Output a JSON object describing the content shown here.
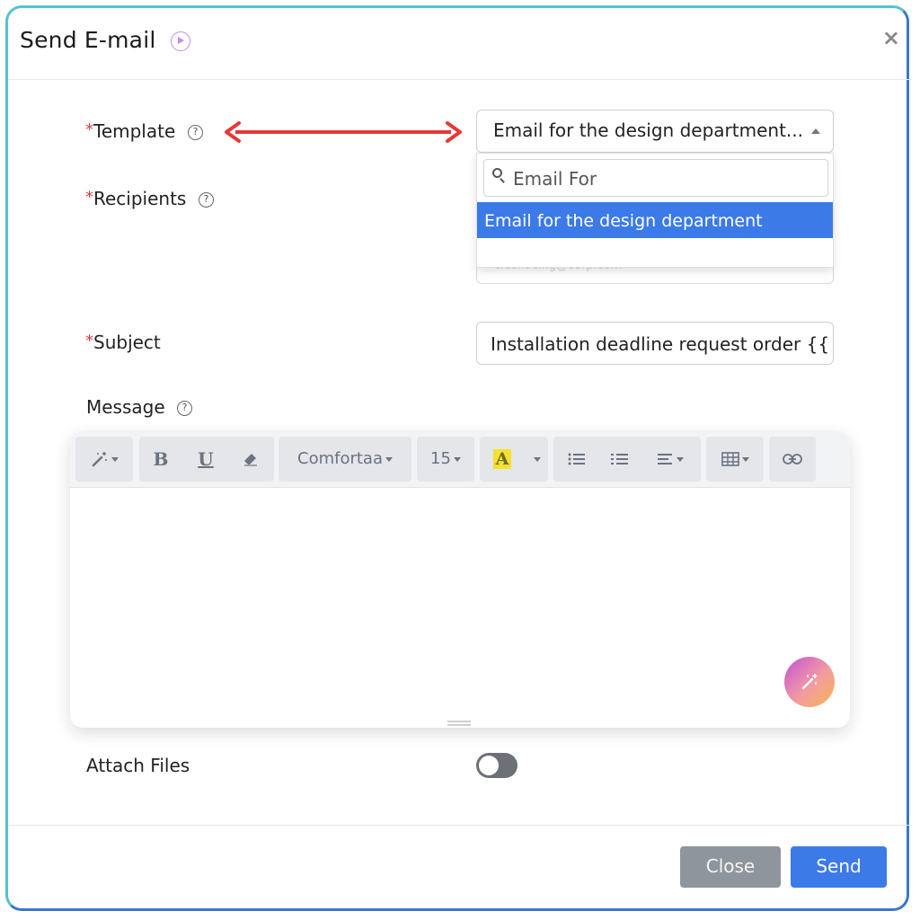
{
  "dialog": {
    "title": "Send E-mail",
    "close_symbol": "×"
  },
  "form": {
    "template": {
      "label": "Template",
      "required_mark": "*",
      "help_symbol": "?",
      "selected_value": "Email for the design department...",
      "dropdown": {
        "search_value": "Email For",
        "options": [
          "Email for the design department"
        ]
      }
    },
    "recipients": {
      "label": "Recipients",
      "required_mark": "*",
      "help_symbol": "?",
      "faint_value": "c.callacing@corp.com"
    },
    "subject": {
      "label": "Subject",
      "required_mark": "*",
      "value": "Installation deadline request order {{"
    },
    "message": {
      "label": "Message",
      "help_symbol": "?",
      "toolbar": {
        "font_family": "Comfortaa",
        "font_size": "15",
        "bold": "B",
        "underline": "U",
        "highlight": "A"
      }
    },
    "attach_files": {
      "label": "Attach Files",
      "enabled": false
    }
  },
  "footer": {
    "close_label": "Close",
    "send_label": "Send"
  },
  "colors": {
    "accent": "#3c7ae8",
    "required": "#e03b3b",
    "arrow": "#e53935"
  }
}
